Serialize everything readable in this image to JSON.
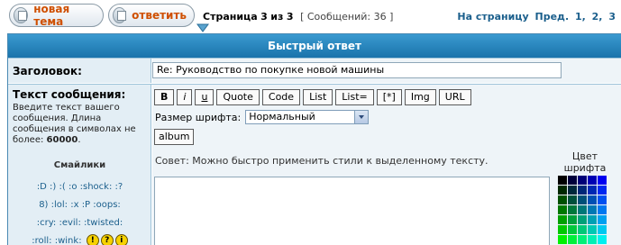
{
  "topbar": {
    "new_topic_label": "новая тема",
    "reply_label": "ответить",
    "page_prefix": "Страница",
    "page_current": "3",
    "page_of": "из",
    "page_total": "3",
    "messages_text": "[ Сообщений: 36 ]",
    "nav_label": "На страницу",
    "nav_prev": "Пред.",
    "nav_pages": [
      "1,",
      "2,",
      "3"
    ]
  },
  "quick_reply": {
    "header": "Быстрый ответ",
    "subject_label": "Заголовок:",
    "subject_value": "Re: Руководство по покупке новой машины",
    "message_label": "Текст сообщения:",
    "message_hint": "Введите текст вашего сообщения. Длина сообщения в символах не более:",
    "message_limit": "60000",
    "smilies_title": "Смайлики",
    "smilies_lines": [
      ":D :) :( :o :shock: :?",
      "8) :lol: :x :P :oops:",
      ":cry: :evil: :twisted:",
      ":roll: :wink:"
    ],
    "smiley_icons": [
      "!",
      "?",
      "i"
    ],
    "format_buttons": [
      "B",
      "i",
      "u",
      "Quote",
      "Code",
      "List",
      "List=",
      "[*]",
      "Img",
      "URL"
    ],
    "font_size_label": "Размер шрифта:",
    "font_size_value": "Нормальный",
    "album_label": "album",
    "tip_text": "Совет: Можно быстро применить стили к выделенному тексту.",
    "color_label": "Цвет шрифта"
  },
  "colors": {
    "header_bg": "#1a73ab",
    "label_bg": "#e3eef5",
    "link": "#1b5f8c",
    "button_text": "#cf4f00"
  }
}
